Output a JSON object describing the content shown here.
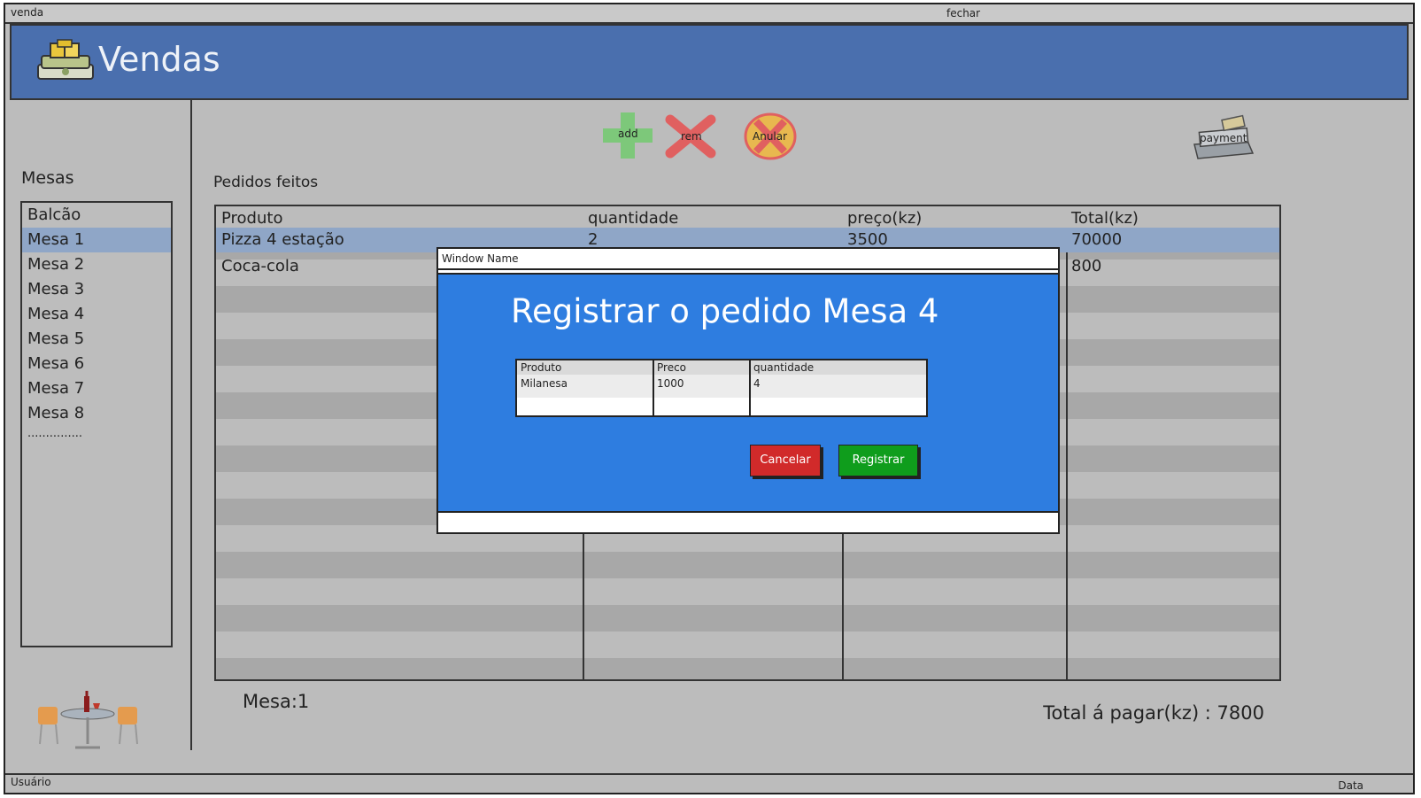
{
  "window": {
    "title": "venda",
    "close_label": "fechar"
  },
  "header": {
    "title": "Vendas",
    "icon": "money-stack-icon"
  },
  "sidebar": {
    "label": "Mesas",
    "items": [
      {
        "label": "Balcão"
      },
      {
        "label": "Mesa 1"
      },
      {
        "label": "Mesa 2"
      },
      {
        "label": "Mesa 3"
      },
      {
        "label": "Mesa 4"
      },
      {
        "label": "Mesa 5"
      },
      {
        "label": "Mesa 6"
      },
      {
        "label": "Mesa 7"
      },
      {
        "label": "Mesa 8"
      }
    ],
    "selected": "Mesa 1",
    "more": "..............."
  },
  "toolbar": {
    "add_label": "add",
    "rem_label": "rem",
    "anular_label": "Anular",
    "payment_label": "payment"
  },
  "orders": {
    "label": "Pedidos feitos",
    "columns": [
      "Produto",
      "quantidade",
      "preço(kz)",
      "Total(kz)"
    ],
    "rows": [
      {
        "produto": "Pizza 4 estação",
        "quantidade": "2",
        "preco": "3500",
        "total": "70000"
      },
      {
        "produto": "Coca-cola",
        "quantidade": "",
        "preco": "",
        "total": "800"
      }
    ]
  },
  "footer": {
    "mesa": "Mesa:1",
    "total": "Total á pagar(kz) : 7800"
  },
  "statusbar": {
    "user": "Usuário",
    "date": "Data"
  },
  "modal": {
    "window_name": "Window Name",
    "heading": "Registrar o pedido Mesa 4",
    "columns": [
      "Produto",
      "Preco",
      "quantidade"
    ],
    "row": {
      "produto": "Milanesa",
      "preco": "1000",
      "quantidade": "4"
    },
    "cancel_label": "Cancelar",
    "register_label": "Registrar"
  },
  "colors": {
    "header": "#4a6fae",
    "modal_body": "#2e7de0",
    "cancel": "#d12a2a",
    "register": "#0f9d1c",
    "selection": "#8fa6c7"
  }
}
